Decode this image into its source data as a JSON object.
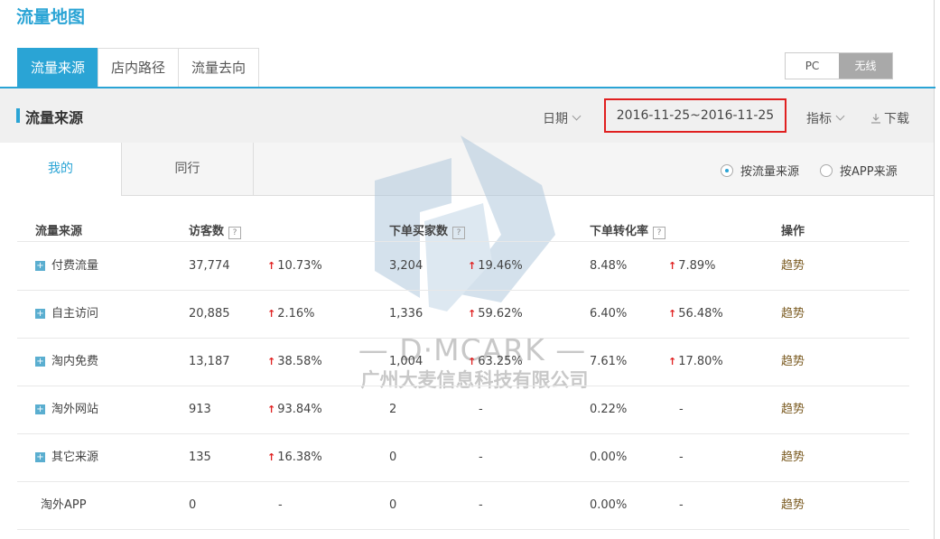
{
  "page": {
    "title": "流量地图"
  },
  "main_tabs": [
    {
      "label": "流量来源",
      "active": true
    },
    {
      "label": "店内路径",
      "active": false
    },
    {
      "label": "流量去向",
      "active": false
    }
  ],
  "device_toggle": {
    "pc": "PC",
    "wireless": "无线",
    "selected": "无线"
  },
  "section": {
    "title": "流量来源",
    "date_label": "日期",
    "date_range": "2016-11-25~2016-11-25",
    "metric_label": "指标",
    "download_label": "下载"
  },
  "sub_tabs": {
    "mine": "我的",
    "peer": "同行"
  },
  "radio": {
    "by_traffic": "按流量来源",
    "by_app": "按APP来源",
    "selected": "by_traffic"
  },
  "table": {
    "headers": {
      "source": "流量来源",
      "visitors": "访客数",
      "buyers": "下单买家数",
      "conversion": "下单转化率",
      "action": "操作"
    },
    "help_icon": "?",
    "rows": [
      {
        "source": "付费流量",
        "expand": true,
        "visitors": "37,774",
        "visitors_change": "10.73%",
        "buyers": "3,204",
        "buyers_change": "19.46%",
        "conversion": "8.48%",
        "conversion_change": "7.89%",
        "action": "趋势"
      },
      {
        "source": "自主访问",
        "expand": true,
        "visitors": "20,885",
        "visitors_change": "2.16%",
        "buyers": "1,336",
        "buyers_change": "59.62%",
        "conversion": "6.40%",
        "conversion_change": "56.48%",
        "action": "趋势"
      },
      {
        "source": "淘内免费",
        "expand": true,
        "visitors": "13,187",
        "visitors_change": "38.58%",
        "buyers": "1,004",
        "buyers_change": "63.25%",
        "conversion": "7.61%",
        "conversion_change": "17.80%",
        "action": "趋势"
      },
      {
        "source": "淘外网站",
        "expand": true,
        "visitors": "913",
        "visitors_change": "93.84%",
        "buyers": "2",
        "buyers_change": "-",
        "conversion": "0.22%",
        "conversion_change": "-",
        "action": "趋势"
      },
      {
        "source": "其它来源",
        "expand": true,
        "visitors": "135",
        "visitors_change": "16.38%",
        "buyers": "0",
        "buyers_change": "-",
        "conversion": "0.00%",
        "conversion_change": "-",
        "action": "趋势"
      },
      {
        "source": "淘外APP",
        "expand": false,
        "visitors": "0",
        "visitors_change": "-",
        "buyers": "0",
        "buyers_change": "-",
        "conversion": "0.00%",
        "conversion_change": "-",
        "action": "趋势"
      }
    ]
  },
  "watermark": {
    "brand": "D·MCARK",
    "company": "广州大麦信息科技有限公司"
  },
  "colors": {
    "accent": "#2aa4d5",
    "up_arrow": "#e02020",
    "highlight_box": "#e02020"
  },
  "icons": {
    "up": "up-arrow-icon",
    "expand": "expand-plus-icon",
    "download": "download-icon",
    "chevron": "chevron-down-icon"
  }
}
